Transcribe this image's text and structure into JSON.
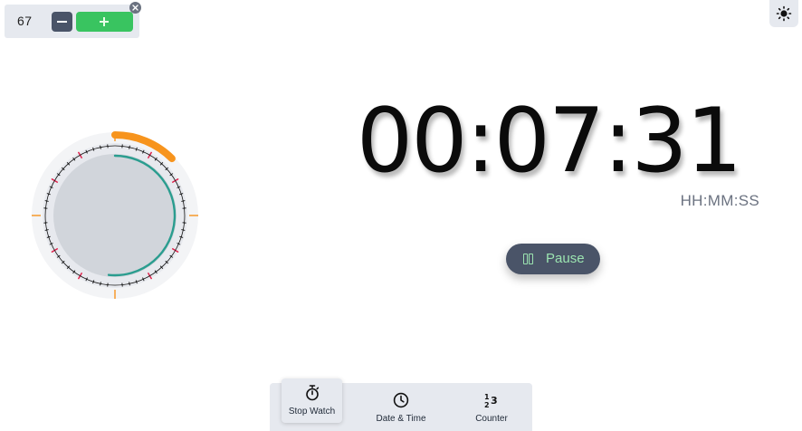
{
  "counter": {
    "value": "67",
    "decrement_icon": "minus-icon",
    "increment_icon": "plus-icon",
    "close_icon": "close-icon",
    "plus_color": "#39c460",
    "minus_color": "#4a5468"
  },
  "theme_toggle": {
    "icon": "sun-icon"
  },
  "stopwatch": {
    "time": "00:07:31",
    "format": "HH:MM:SS",
    "pause_label": "Pause",
    "pause_icon": "pause-icon",
    "elapsed_minutes_fraction": 0.125,
    "elapsed_seconds_fraction": 0.5167,
    "accent_orange": "#f7941d",
    "accent_teal": "#2a9d8f",
    "accent_red": "#e11d48"
  },
  "bottom_nav": {
    "items": [
      {
        "label": "Stop Watch",
        "icon": "stopwatch-icon",
        "active": true
      },
      {
        "label": "Date & Time",
        "icon": "clock-icon",
        "active": false
      },
      {
        "label": "Counter",
        "icon": "counter-icon",
        "active": false
      }
    ]
  }
}
